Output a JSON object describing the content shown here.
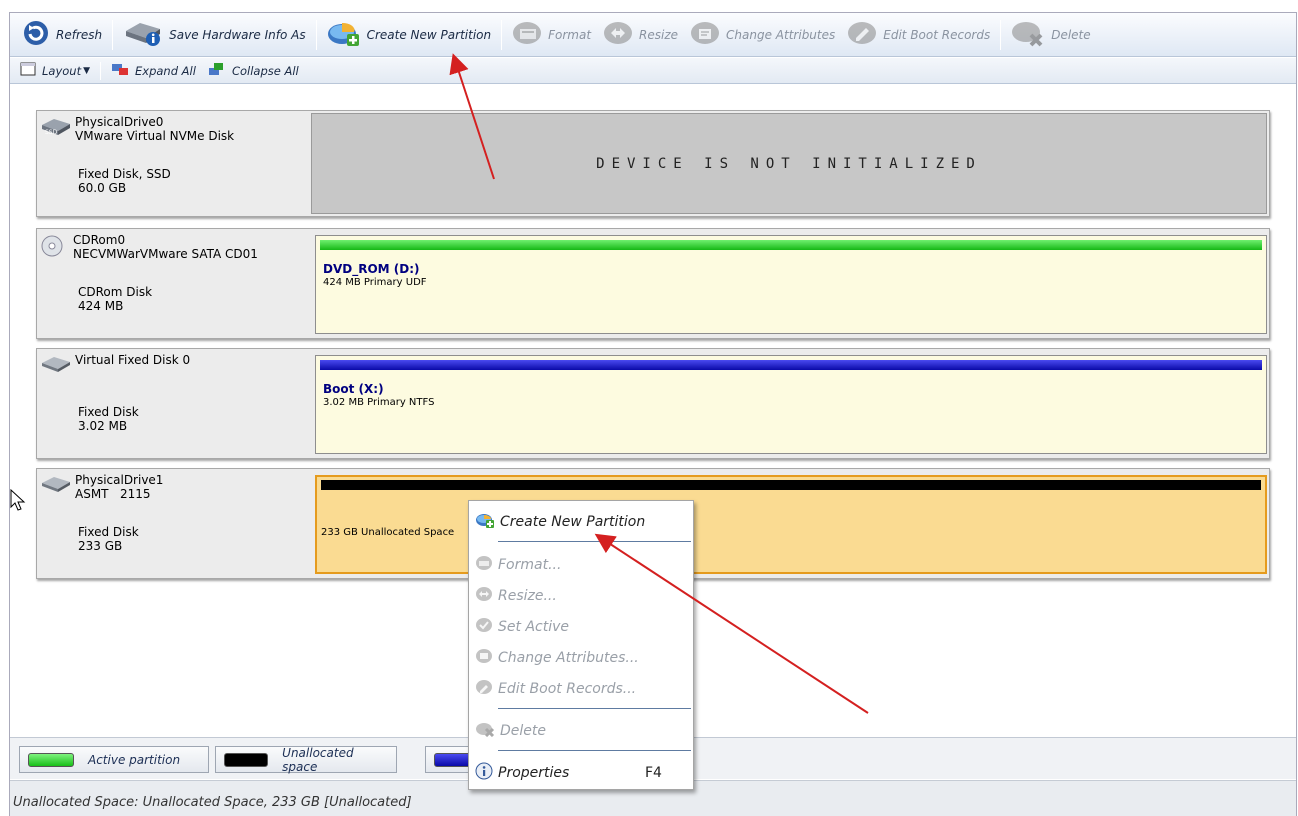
{
  "toolbar": {
    "refresh": "Refresh",
    "save_hw": "Save Hardware Info As",
    "create": "Create New Partition",
    "format": "Format",
    "resize": "Resize",
    "change_attr": "Change Attributes",
    "edit_boot": "Edit Boot Records",
    "delete": "Delete"
  },
  "toolbar2": {
    "layout": "Layout",
    "expand_all": "Expand All",
    "collapse_all": "Collapse All"
  },
  "disks": [
    {
      "name": "PhysicalDrive0",
      "model": "VMware Virtual NVMe Disk",
      "type": "Fixed Disk, SSD",
      "size": "60.0 GB",
      "message": "DEVICE IS NOT INITIALIZED"
    },
    {
      "name": "CDRom0",
      "model": "NECVMWarVMware SATA CD01",
      "type": "CDRom Disk",
      "size": "424 MB",
      "partition_title": "DVD_ROM (D:)",
      "partition_desc": "424 MB Primary UDF",
      "bar_color": "#22cc22"
    },
    {
      "name": "Virtual Fixed Disk 0",
      "model": "",
      "type": "Fixed Disk",
      "size": "3.02 MB",
      "partition_title": "Boot (X:)",
      "partition_desc": "3.02 MB Primary NTFS",
      "bar_color": "#1414c8"
    },
    {
      "name": "PhysicalDrive1",
      "model": "ASMT   2115",
      "type": "Fixed Disk",
      "size": "233 GB",
      "partition_desc": "233 GB Unallocated Space",
      "bar_color": "#000000"
    }
  ],
  "legend": {
    "active": "Active partition",
    "unallocated": "Unallocated space",
    "active_color": "#33d633",
    "unallocated_color": "#000000",
    "primary_color": "#1a1ad0"
  },
  "status_text": "Unallocated Space: Unallocated Space, 233 GB [Unallocated]",
  "context_menu": {
    "create": "Create New Partition",
    "format": "Format...",
    "resize": "Resize...",
    "set_active": "Set Active",
    "change_attr": "Change Attributes...",
    "edit_boot": "Edit Boot Records...",
    "delete": "Delete",
    "properties": "Properties",
    "properties_shortcut": "F4"
  },
  "annotation_color": "#d42020"
}
